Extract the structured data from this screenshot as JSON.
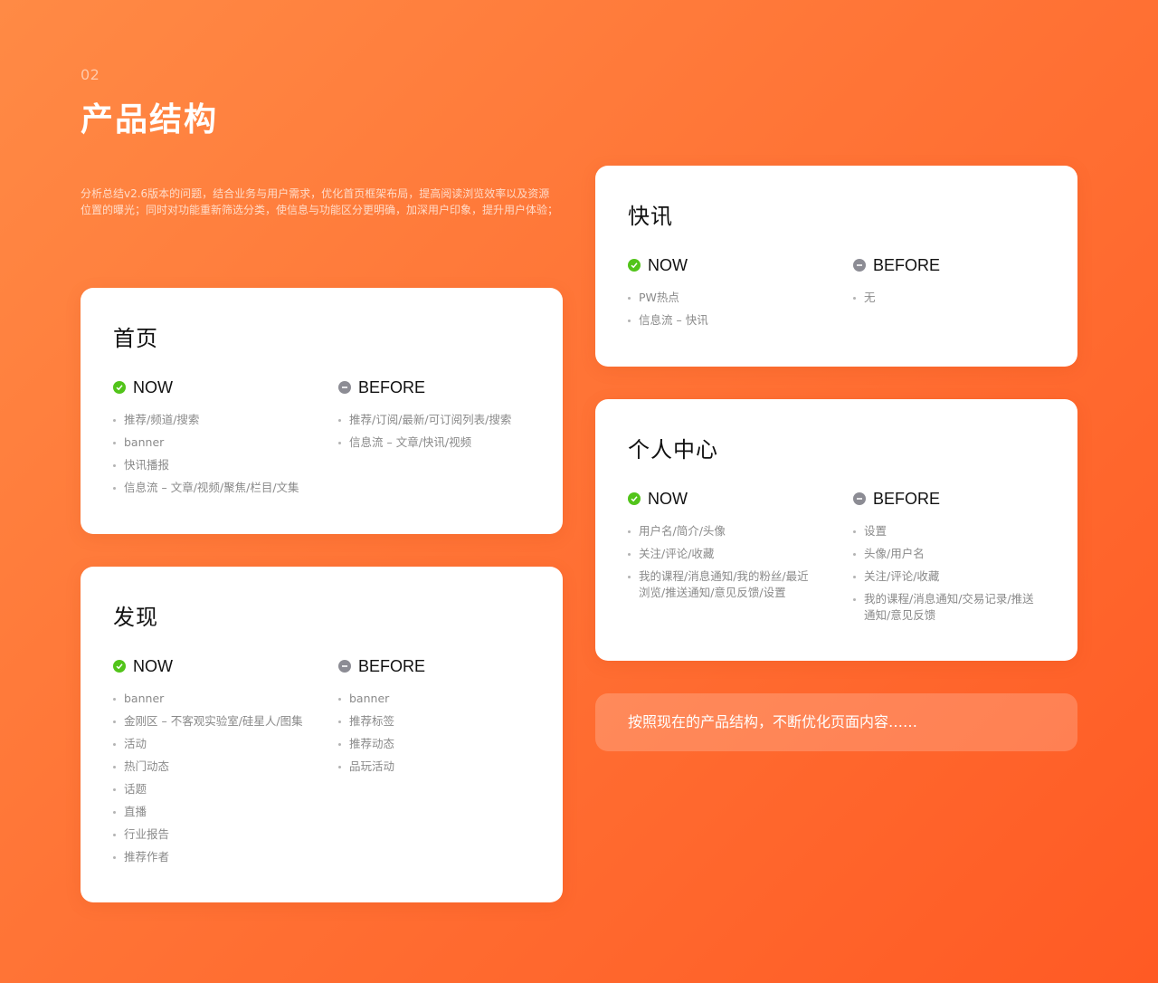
{
  "header": {
    "section_number": "02",
    "title": "产品结构",
    "intro": "分析总结v2.6版本的问题，结合业务与用户需求，优化首页框架布局，提高阅读浏览效率以及资源位置的曝光；同时对功能重新筛选分类，使信息与功能区分更明确，加深用户印象，提升用户体验；"
  },
  "labels": {
    "now": "NOW",
    "before": "BEFORE"
  },
  "icons": {
    "now": "check-circle-icon",
    "before": "minus-circle-icon"
  },
  "colors": {
    "now": "#52c41a",
    "before": "#8c8c94",
    "accent": "#ff6a2c"
  },
  "cards": {
    "home": {
      "title": "首页",
      "now": [
        "推荐/频道/搜索",
        "banner",
        "快讯播报",
        "信息流 – 文章/视频/聚焦/栏目/文集"
      ],
      "before": [
        "推荐/订阅/最新/可订阅列表/搜索",
        "信息流 – 文章/快讯/视频"
      ]
    },
    "discover": {
      "title": "发现",
      "now": [
        "banner",
        "金刚区 – 不客观实验室/硅星人/图集",
        "活动",
        "热门动态",
        "话题",
        "直播",
        "行业报告",
        "推荐作者"
      ],
      "before": [
        "banner",
        "推荐标签",
        "推荐动态",
        "品玩活动"
      ]
    },
    "news": {
      "title": "快讯",
      "now": [
        "PW热点",
        "信息流 – 快讯"
      ],
      "before": [
        "无"
      ]
    },
    "profile": {
      "title": "个人中心",
      "now": [
        "用户名/简介/头像",
        "关注/评论/收藏",
        "我的课程/消息通知/我的粉丝/最近浏览/推送通知/意见反馈/设置"
      ],
      "before": [
        "设置",
        "头像/用户名",
        "关注/评论/收藏",
        "我的课程/消息通知/交易记录/推送通知/意见反馈"
      ]
    }
  },
  "callout": "按照现在的产品结构，不断优化页面内容……"
}
